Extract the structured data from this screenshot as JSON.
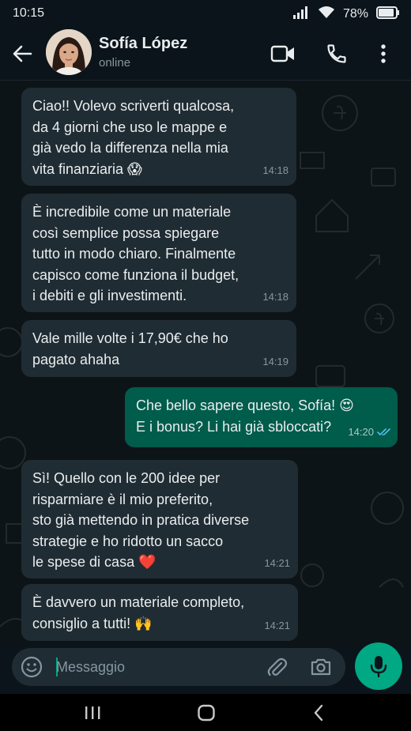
{
  "status_bar": {
    "time": "10:15",
    "battery": "78%"
  },
  "header": {
    "name": "Sofía López",
    "status": "online"
  },
  "messages": [
    {
      "dir": "in",
      "text": "Ciao!! Volevo scriverti qualcosa,\nda 4 giorni che uso le mappe e\ngià vedo la differenza nella mia\nvita finanziaria 😱",
      "time": "14:18"
    },
    {
      "dir": "in",
      "text": "È incredibile come un materiale\ncosì semplice possa spiegare\ntutto in modo chiaro. Finalmente\ncapisco come funziona il budget,\ni debiti e gli investimenti.",
      "time": "14:18"
    },
    {
      "dir": "in",
      "text": "Vale mille volte i 17,90€ che ho\npagato ahaha",
      "time": "14:19"
    },
    {
      "dir": "out",
      "text": "Che bello sapere questo, Sofía! 😍\nE i bonus? Li hai già sbloccati?",
      "time": "14:20",
      "status": "read"
    },
    {
      "dir": "in",
      "text": "Sì! Quello con le 200 idee per\nrisparmiare è il mio preferito,\nsto già mettendo in pratica diverse\nstrategie e ho ridotto un sacco\nle spese di casa ❤️",
      "time": "14:21"
    },
    {
      "dir": "in",
      "text": "È davvero un materiale completo,\nconsiglio a tutti! 🙌",
      "time": "14:21"
    }
  ],
  "composer": {
    "placeholder": "Messaggio"
  },
  "colors": {
    "incoming_bubble": "#202c33",
    "outgoing_bubble": "#005c4b",
    "accent": "#00a884",
    "read_ticks": "#53bdeb"
  }
}
